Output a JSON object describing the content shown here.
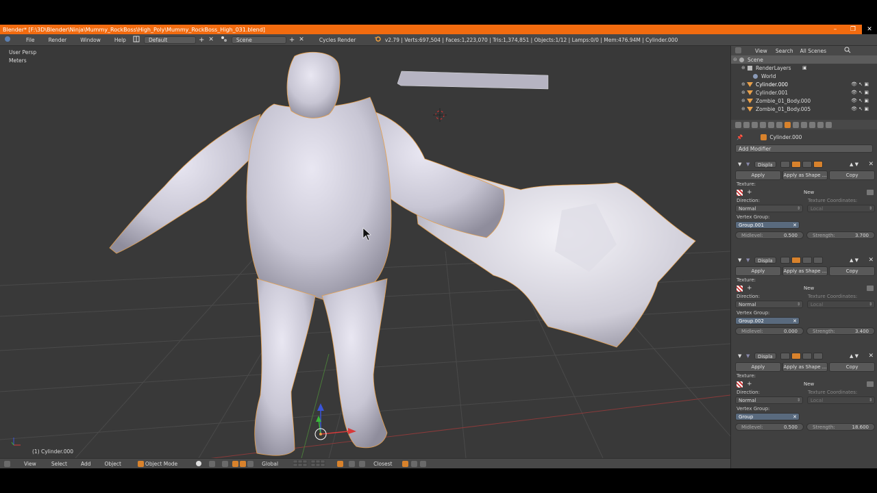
{
  "titlebar": {
    "title": "Blender* [F:\\3D\\Blender\\Ninja\\Mummy_RockBoss\\High_Poly\\Mummy_RockBoss_High_031.blend]",
    "minimize": "–",
    "maximize": "❐",
    "close": "✕"
  },
  "infobar": {
    "menu": [
      "File",
      "Render",
      "Window",
      "Help"
    ],
    "layout": "Default",
    "scene": "Scene",
    "engine": "Cycles Render",
    "stats": "v2.79 | Verts:697,504 | Faces:1,223,070 | Tris:1,374,851 | Objects:1/12 | Lamps:0/0 | Mem:476.94M | Cylinder.000"
  },
  "viewport": {
    "view_name": "User Persp",
    "units": "Meters",
    "active_object": "(1) Cylinder.000"
  },
  "vpheader": {
    "view": "View",
    "select": "Select",
    "add": "Add",
    "object": "Object",
    "mode": "Object Mode",
    "orientation": "Global",
    "snap": "Closest"
  },
  "outliner": {
    "view": "View",
    "search": "Search",
    "all_scenes": "All Scenes",
    "rows": [
      {
        "label": "Scene"
      },
      {
        "label": "RenderLayers"
      },
      {
        "label": "World"
      },
      {
        "label": "Cylinder.000"
      },
      {
        "label": "Cylinder.001"
      },
      {
        "label": "Zombie_01_Body.000"
      },
      {
        "label": "Zombie_01_Body.005"
      }
    ]
  },
  "properties": {
    "object_name": "Cylinder.000",
    "add_modifier": "Add Modifier",
    "modifiers": [
      {
        "name": "Displa",
        "apply": "Apply",
        "apply_shape": "Apply as Shape ...",
        "copy": "Copy",
        "texture_label": "Texture:",
        "new": "New",
        "direction_label": "Direction:",
        "texcoords_label": "Texture Coordinates:",
        "direction": "Normal",
        "texcoords": "Local",
        "vgroup_label": "Vertex Group:",
        "vgroup": "Group.001",
        "midlevel_label": "Midlevel:",
        "midlevel": "0.500",
        "strength_label": "Strength:",
        "strength": "3.700"
      },
      {
        "name": "Displa",
        "apply": "Apply",
        "apply_shape": "Apply as Shape ...",
        "copy": "Copy",
        "texture_label": "Texture:",
        "new": "New",
        "direction_label": "Direction:",
        "texcoords_label": "Texture Coordinates:",
        "direction": "Normal",
        "texcoords": "Local",
        "vgroup_label": "Vertex Group:",
        "vgroup": "Group.002",
        "midlevel_label": "Midlevel:",
        "midlevel": "0.000",
        "strength_label": "Strength:",
        "strength": "3.400"
      },
      {
        "name": "Displa",
        "apply": "Apply",
        "apply_shape": "Apply as Shape ...",
        "copy": "Copy",
        "texture_label": "Texture:",
        "new": "New",
        "direction_label": "Direction:",
        "texcoords_label": "Texture Coordinates:",
        "direction": "Normal",
        "texcoords": "Local",
        "vgroup_label": "Vertex Group:",
        "vgroup": "Group",
        "midlevel_label": "Midlevel:",
        "midlevel": "0.500",
        "strength_label": "Strength:",
        "strength": "18.600"
      }
    ]
  },
  "colors": {
    "accent": "#f26b0f",
    "panel": "#404040",
    "viewport": "#393939",
    "selection_outline": "#e8a04a"
  }
}
